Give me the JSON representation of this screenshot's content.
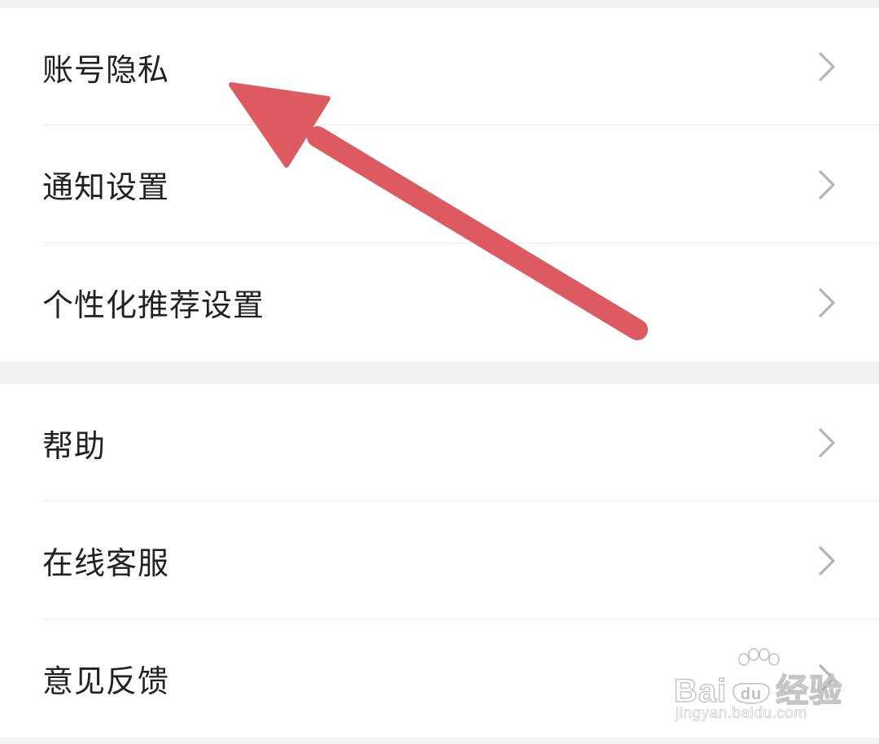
{
  "settings_groups": [
    {
      "items": [
        {
          "label": "账号隐私"
        },
        {
          "label": "通知设置"
        },
        {
          "label": "个性化推荐设置"
        }
      ]
    },
    {
      "items": [
        {
          "label": "帮助"
        },
        {
          "label": "在线客服"
        },
        {
          "label": "意见反馈"
        }
      ]
    }
  ],
  "annotation": {
    "arrow_color": "#dc5a60",
    "points_to": "账号隐私"
  },
  "watermark": {
    "brand_left": "Bai",
    "brand_right": "经验",
    "url": "jingyan.baidu.com"
  },
  "colors": {
    "background": "#f2f2f2",
    "row_background": "#ffffff",
    "label_text": "#222222",
    "chevron": "#b4b4b4",
    "divider": "#ececec"
  }
}
